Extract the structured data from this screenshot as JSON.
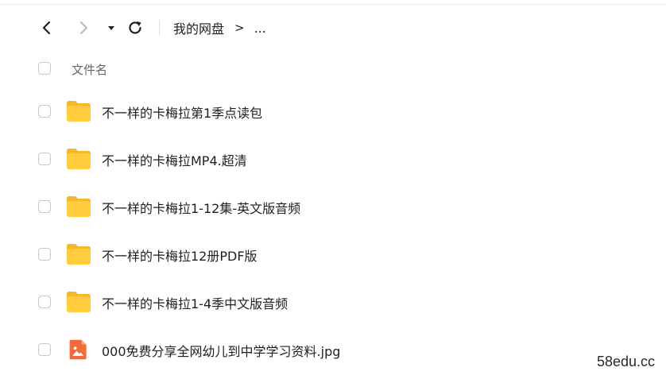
{
  "toolbar": {
    "back_icon": "chevron-left-icon",
    "forward_icon": "chevron-right-icon",
    "history_icon": "caret-down-icon",
    "refresh_icon": "refresh-icon"
  },
  "breadcrumb": {
    "root": "我的网盘",
    "separator": ">",
    "ellipsis": "..."
  },
  "list_header": {
    "name_label": "文件名"
  },
  "files": [
    {
      "name": "不一样的卡梅拉第1季点读包",
      "type": "folder",
      "icon": "folder-icon"
    },
    {
      "name": "不一样的卡梅拉MP4.超清",
      "type": "folder",
      "icon": "folder-icon"
    },
    {
      "name": "不一样的卡梅拉1-12集-英文版音频",
      "type": "folder",
      "icon": "folder-icon"
    },
    {
      "name": "不一样的卡梅拉12册PDF版",
      "type": "folder",
      "icon": "folder-icon"
    },
    {
      "name": "不一样的卡梅拉1-4季中文版音频",
      "type": "folder",
      "icon": "folder-icon"
    },
    {
      "name": "000免费分享全网幼儿到中学学习资料.jpg",
      "type": "image",
      "icon": "image-file-icon"
    }
  ],
  "colors": {
    "folder": "#FFCC3D",
    "folder_back": "#F5B82A",
    "image_file": "#F26B3A",
    "checkbox_border": "#C9C9C9"
  },
  "watermark": "58edu.cc"
}
